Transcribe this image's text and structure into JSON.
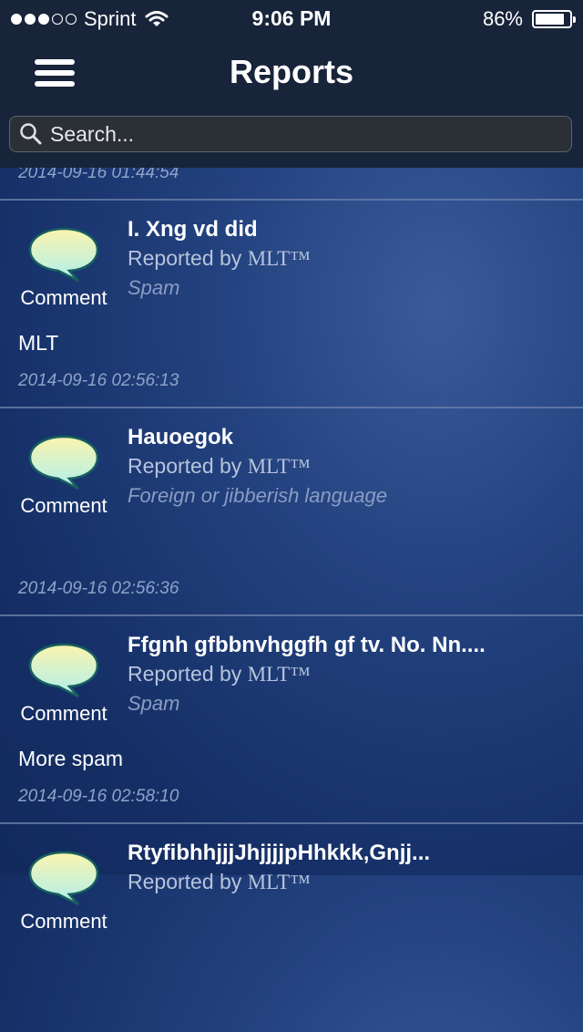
{
  "status_bar": {
    "signal_bars_filled": 3,
    "signal_bars_total": 5,
    "carrier": "Sprint",
    "time": "9:06 PM",
    "battery_text": "86%",
    "battery_level": 0.86
  },
  "header": {
    "title": "Reports",
    "menu_icon": "hamburger-menu-icon"
  },
  "search": {
    "placeholder": "Search...",
    "value": ""
  },
  "partial_item_timestamp": "2014-09-16 01:44:54",
  "reports": [
    {
      "type_label": "Comment",
      "icon": "comment-bubble-icon",
      "title": "I. Xng vd did",
      "reported_by_prefix": "Reported by",
      "reported_by_user": "MLT™",
      "reason": "Spam",
      "note": "MLT",
      "timestamp": "2014-09-16 02:56:13"
    },
    {
      "type_label": "Comment",
      "icon": "comment-bubble-icon",
      "title": "Hauoegok",
      "reported_by_prefix": "Reported by",
      "reported_by_user": "MLT™",
      "reason": "Foreign or jibberish language",
      "note": "",
      "timestamp": "2014-09-16 02:56:36"
    },
    {
      "type_label": "Comment",
      "icon": "comment-bubble-icon",
      "title": "Ffgnh gfbbnvhggfh gf tv. No. Nn....",
      "reported_by_prefix": "Reported by",
      "reported_by_user": "MLT™",
      "reason": "Spam",
      "note": "More spam",
      "timestamp": "2014-09-16 02:58:10"
    },
    {
      "type_label": "Comment",
      "icon": "comment-bubble-icon",
      "title": "RtyfibhhjjjJhjjjjpHhkkk,Gnjj...",
      "reported_by_prefix": "Reported by",
      "reported_by_user": "MLT™",
      "reason": "",
      "note": "",
      "timestamp": ""
    }
  ]
}
